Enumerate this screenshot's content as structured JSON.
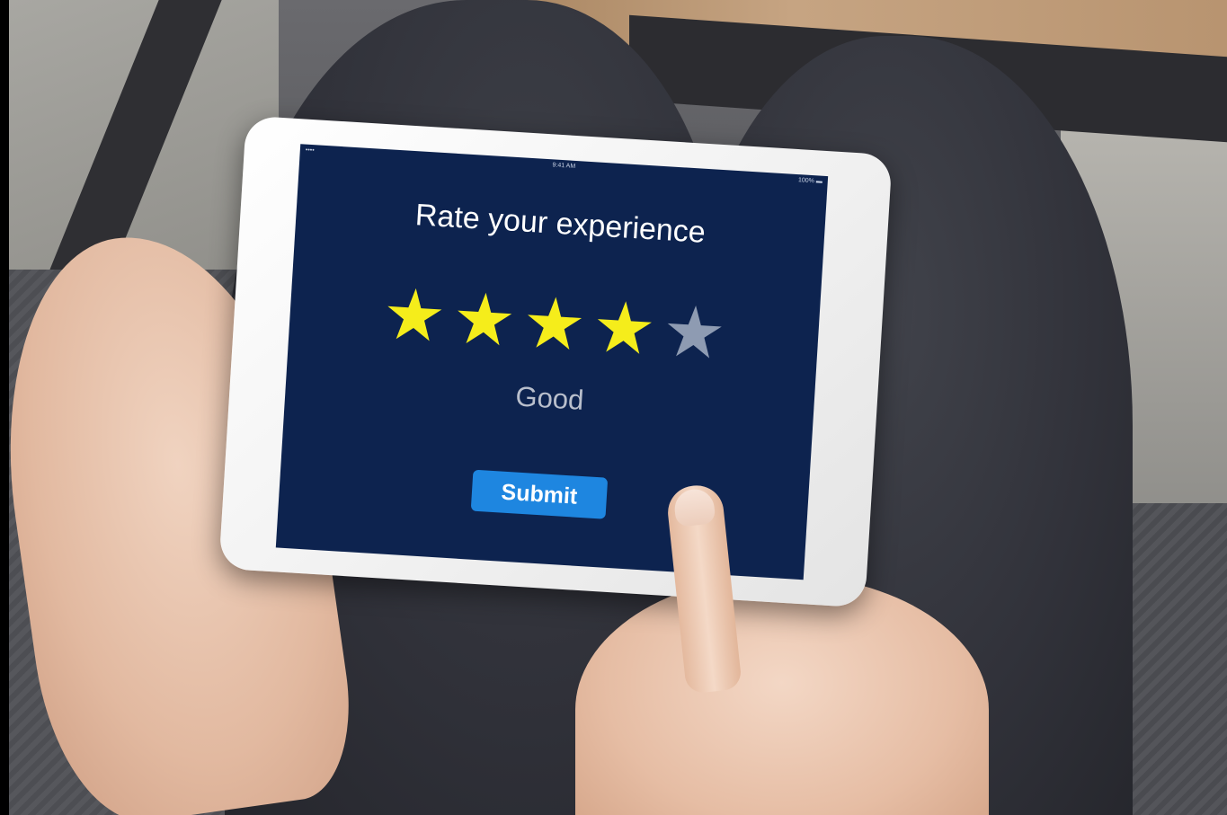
{
  "status_bar": {
    "signal": "••••",
    "time": "9:41 AM",
    "battery": "100% ▬"
  },
  "survey": {
    "title": "Rate your experience",
    "rating": 4,
    "max_rating": 5,
    "rating_label": "Good",
    "submit_label": "Submit"
  },
  "colors": {
    "screen_background": "#0d234f",
    "star_filled": "#f5ed1b",
    "star_empty": "#8e9bb2",
    "button": "#1e86e0"
  },
  "icons": {
    "star": "star-icon"
  }
}
